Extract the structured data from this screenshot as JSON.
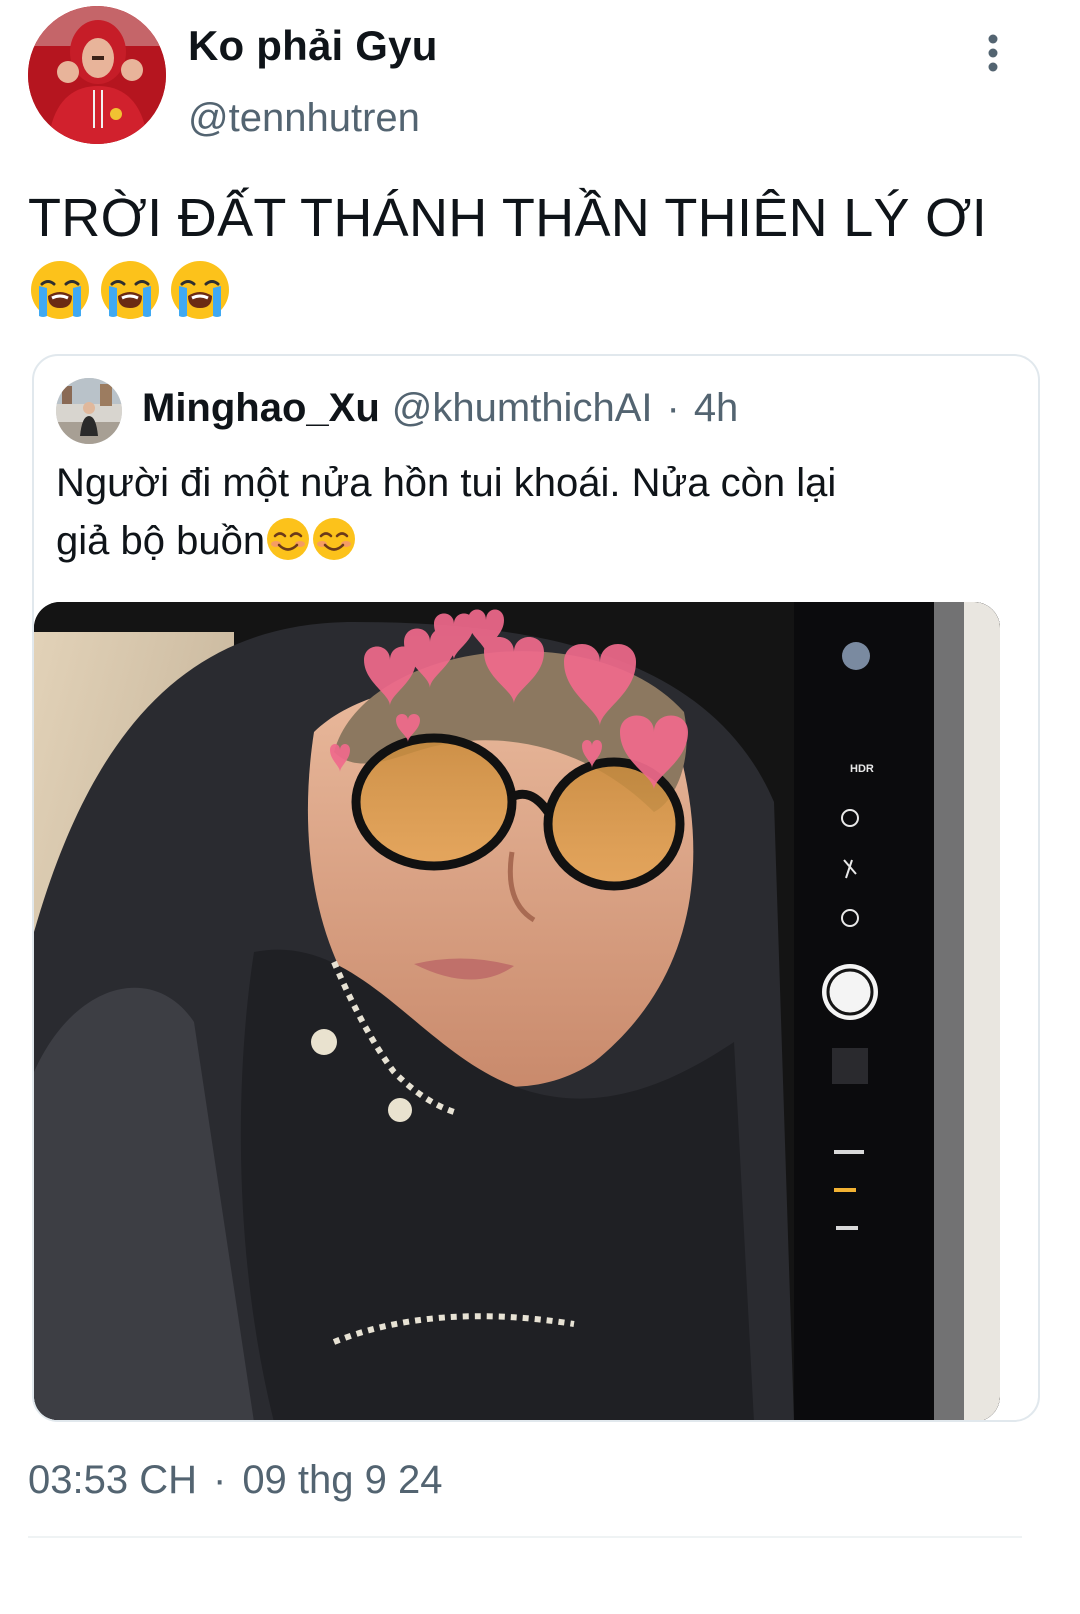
{
  "author": {
    "display_name": "Ko phải Gyu",
    "handle": "@tennhutren"
  },
  "tweet": {
    "text": "TRỜI ĐẤT THÁNH THẦN THIÊN LÝ ƠI",
    "emojis": [
      "loudly-crying-face",
      "loudly-crying-face",
      "loudly-crying-face"
    ]
  },
  "quoted": {
    "display_name": "Minghao_Xu",
    "handle": "@khumthichAI",
    "separator": "·",
    "time": "4h",
    "text_line1": "Người đi một nửa hồn tui khoái. Nửa còn lại",
    "text_line2": "giả bộ buồn",
    "emojis": [
      "smiling-face-with-smiling-eyes",
      "smiling-face-with-smiling-eyes"
    ],
    "camera_ui": {
      "hdr": "HDR"
    }
  },
  "footer": {
    "time": "03:53 CH",
    "separator": "·",
    "date": "09 thg 9 24"
  },
  "colors": {
    "text_primary": "#0f1419",
    "text_secondary": "#536471",
    "border": "#e1e8ed",
    "heart": "#f06a8c"
  }
}
